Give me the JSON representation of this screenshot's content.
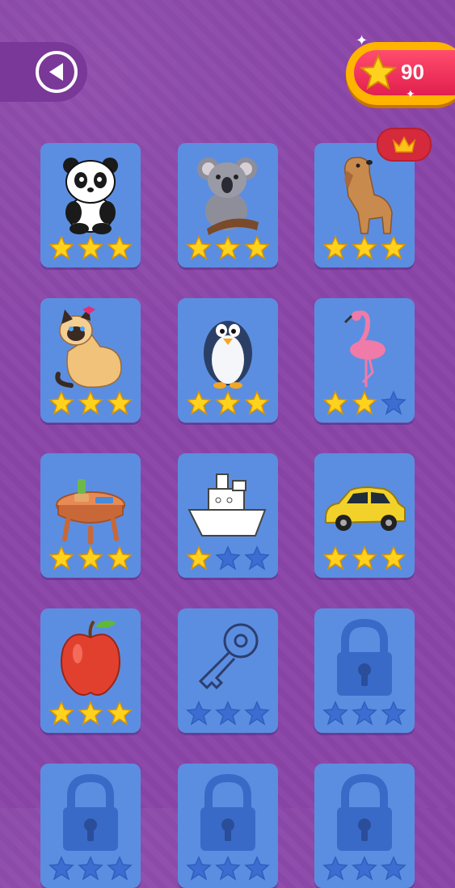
{
  "header": {
    "score": "90",
    "back_icon": "back-arrow-icon",
    "score_icon": "star-icon"
  },
  "colors": {
    "background": "#8a45a8",
    "card": "#5b8ee0",
    "star_filled": "#ffd21e",
    "star_empty": "#3b6ed0",
    "score_pill": "#e21f4e",
    "crown_badge": "#d42a3c"
  },
  "levels": [
    {
      "name": "panda",
      "icon": "panda-icon",
      "stars": 3,
      "locked": false,
      "premium": false
    },
    {
      "name": "koala",
      "icon": "koala-icon",
      "stars": 3,
      "locked": false,
      "premium": false
    },
    {
      "name": "dog",
      "icon": "dog-icon",
      "stars": 3,
      "locked": false,
      "premium": true
    },
    {
      "name": "cat",
      "icon": "cat-icon",
      "stars": 3,
      "locked": false,
      "premium": false
    },
    {
      "name": "penguin",
      "icon": "penguin-icon",
      "stars": 3,
      "locked": false,
      "premium": false
    },
    {
      "name": "flamingo",
      "icon": "flamingo-icon",
      "stars": 2,
      "locked": false,
      "premium": false
    },
    {
      "name": "table",
      "icon": "table-icon",
      "stars": 3,
      "locked": false,
      "premium": false
    },
    {
      "name": "boat",
      "icon": "boat-icon",
      "stars": 1,
      "locked": false,
      "premium": false
    },
    {
      "name": "car",
      "icon": "car-icon",
      "stars": 3,
      "locked": false,
      "premium": false
    },
    {
      "name": "apple",
      "icon": "apple-icon",
      "stars": 3,
      "locked": false,
      "premium": false
    },
    {
      "name": "key",
      "icon": "key-icon",
      "stars": 0,
      "locked": false,
      "premium": false
    },
    {
      "name": "locked",
      "icon": "lock-icon",
      "stars": 0,
      "locked": true,
      "premium": false
    },
    {
      "name": "locked",
      "icon": "lock-icon",
      "stars": 0,
      "locked": true,
      "premium": false
    },
    {
      "name": "locked",
      "icon": "lock-icon",
      "stars": 0,
      "locked": true,
      "premium": false
    },
    {
      "name": "locked",
      "icon": "lock-icon",
      "stars": 0,
      "locked": true,
      "premium": false
    }
  ]
}
